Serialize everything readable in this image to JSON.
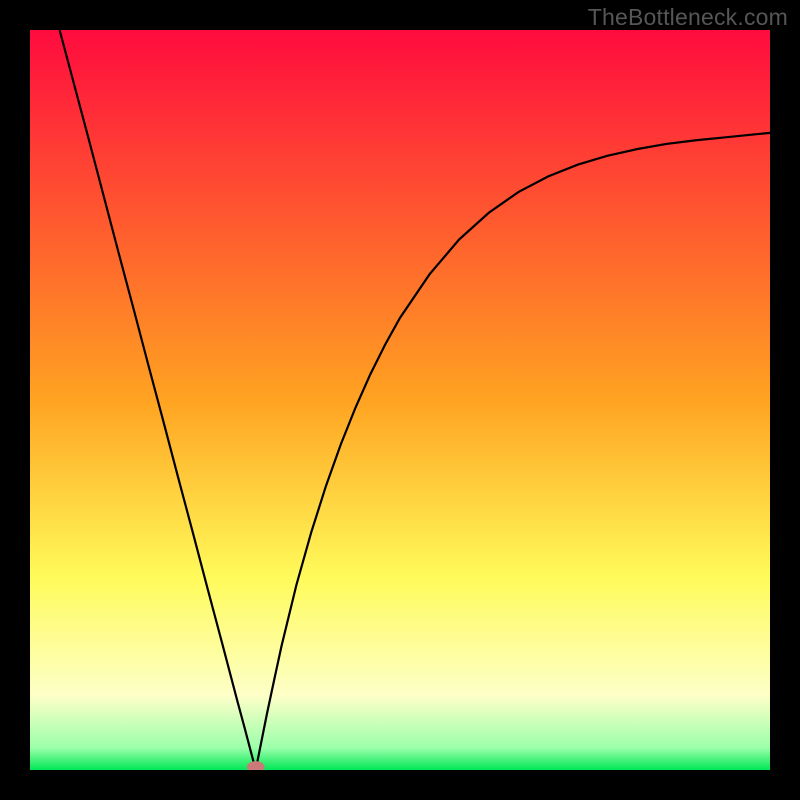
{
  "watermark": "TheBottleneck.com",
  "chart_data": {
    "type": "line",
    "title": "",
    "xlabel": "",
    "ylabel": "",
    "xlim": [
      0,
      100
    ],
    "ylim": [
      0,
      100
    ],
    "background_gradient": {
      "stops": [
        {
          "offset": 0.0,
          "color": "#ff0b3e"
        },
        {
          "offset": 0.5,
          "color": "#ffa321"
        },
        {
          "offset": 0.74,
          "color": "#fffb5a"
        },
        {
          "offset": 0.9,
          "color": "#fdffc8"
        },
        {
          "offset": 0.97,
          "color": "#9bffaa"
        },
        {
          "offset": 1.0,
          "color": "#00e756"
        }
      ]
    },
    "marker": {
      "x": 30.5,
      "y": 0,
      "color": "#c97a79",
      "rx": 1.2,
      "ry": 0.8
    },
    "series": [
      {
        "name": "bottleneck-curve",
        "color": "#000000",
        "x": [
          4,
          6,
          8,
          10,
          12,
          14,
          16,
          18,
          20,
          22,
          24,
          26,
          28,
          29,
          30,
          30.5,
          31,
          32,
          33,
          34,
          36,
          38,
          40,
          42,
          44,
          46,
          48,
          50,
          54,
          58,
          62,
          66,
          70,
          74,
          78,
          82,
          86,
          90,
          94,
          98,
          100
        ],
        "y": [
          100,
          92.5,
          85,
          77.4,
          69.8,
          62.3,
          54.7,
          47.2,
          39.6,
          32.1,
          24.5,
          17,
          9.4,
          5.7,
          1.9,
          0,
          2.5,
          7.5,
          12.2,
          16.8,
          25,
          32.1,
          38.4,
          44,
          49,
          53.5,
          57.5,
          61.1,
          67,
          71.7,
          75.3,
          78.1,
          80.2,
          81.8,
          83,
          83.9,
          84.6,
          85.1,
          85.5,
          85.9,
          86.1
        ]
      }
    ]
  }
}
